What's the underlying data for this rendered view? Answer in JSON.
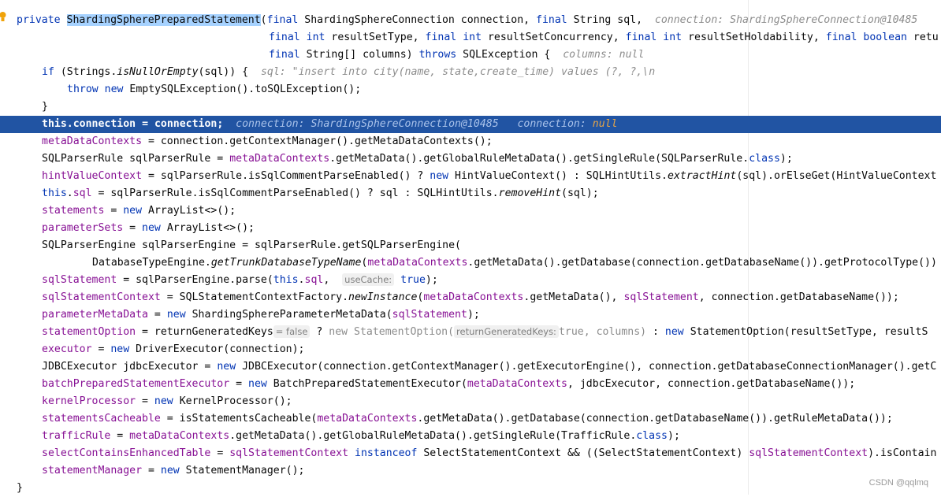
{
  "watermark": "CSDN @qqlmq",
  "lines": {
    "l1": {
      "kw_private": "private",
      "class_name": "ShardingSpherePreparedStatement",
      "sig_rest": "(",
      "kw_final": "final",
      "sig_text": " ShardingSphereConnection connection, ",
      "kw_final2": "final",
      "sig_text2": " String sql,",
      "hint": "connection: ShardingSphereConnection@10485"
    },
    "l2": {
      "kw1": "final",
      "kw2": "int",
      "t1": " resultSetType, ",
      "kw3": "final",
      "kw4": "int",
      "t2": " resultSetConcurrency, ",
      "kw5": "final",
      "kw6": "int",
      "t3": " resultSetHoldability, ",
      "kw7": "final",
      "kw8": "boolean",
      "t4": " retu"
    },
    "l3": {
      "kw1": "final",
      "t1": " String[] columns) ",
      "kw2": "throws",
      "t2": " SQLException {",
      "hint": "columns: null"
    },
    "l4": {
      "kw1": "if",
      "t1": " (Strings.",
      "m1": "isNullOrEmpty",
      "t2": "(sql)) {",
      "hint": "sql: \"insert into city(name, state,create_time) values (?, ?,\\n"
    },
    "l5": {
      "kw1": "throw",
      "kw2": "new",
      "t1": " EmptySQLException().toSQLException();"
    },
    "l6": {
      "t1": "}"
    },
    "l7": {
      "kw1": "this",
      "t1": ".",
      "f1": "connection",
      "t2": " = connection;",
      "hint1": "connection: ShardingSphereConnection@10485",
      "hint2": "connection:",
      "hint3": "null"
    },
    "l8": {
      "f1": "metaDataContexts",
      "t1": " = connection.getContextManager().getMetaDataContexts();"
    },
    "l9": {
      "t1": "SQLParserRule sqlParserRule = ",
      "f1": "metaDataContexts",
      "t2": ".getMetaData().getGlobalRuleMetaData().getSingleRule(SQLParserRule.",
      "kw1": "class",
      "t3": ");"
    },
    "l10": {
      "f1": "hintValueContext",
      "t1": " = sqlParserRule.isSqlCommentParseEnabled() ? ",
      "kw1": "new",
      "t2": " HintValueContext() : SQLHintUtils.",
      "m1": "extractHint",
      "t3": "(sql).orElseGet(HintValueContext"
    },
    "l11": {
      "kw1": "this",
      "t1": ".",
      "f1": "sql",
      "t2": " = sqlParserRule.isSqlCommentParseEnabled() ? sql : SQLHintUtils.",
      "m1": "removeHint",
      "t3": "(sql);"
    },
    "l12": {
      "f1": "statements",
      "t1": " = ",
      "kw1": "new",
      "t2": " ArrayList<>();"
    },
    "l13": {
      "f1": "parameterSets",
      "t1": " = ",
      "kw1": "new",
      "t2": " ArrayList<>();"
    },
    "l14": {
      "t1": "SQLParserEngine sqlParserEngine = sqlParserRule.getSQLParserEngine("
    },
    "l15": {
      "t1": "DatabaseTypeEngine.",
      "m1": "getTrunkDatabaseTypeName",
      "t2": "(",
      "f1": "metaDataContexts",
      "t3": ".getMetaData().getDatabase(connection.getDatabaseName()).getProtocolType())"
    },
    "l16": {
      "f1": "sqlStatement",
      "t1": " = sqlParserEngine.parse(",
      "kw1": "this",
      "t2": ".",
      "f2": "sql",
      "t3": ",",
      "inlay": "useCache:",
      "kw2": "true",
      "t4": ");"
    },
    "l17": {
      "f1": "sqlStatementContext",
      "t1": " = SQLStatementContextFactory.",
      "m1": "newInstance",
      "t2": "(",
      "f2": "metaDataContexts",
      "t3": ".getMetaData(), ",
      "f3": "sqlStatement",
      "t4": ", connection.getDatabaseName());"
    },
    "l18": {
      "f1": "parameterMetaData",
      "t1": " = ",
      "kw1": "new",
      "t2": " ShardingSphereParameterMetaData(",
      "f2": "sqlStatement",
      "t3": ");"
    },
    "l19": {
      "f1": "statementOption",
      "t1": " = returnGeneratedKeys",
      "inlay1": "= false",
      "t2": " ? ",
      "g1": "new StatementOption(",
      "inlay2": "returnGeneratedKeys:",
      "g2": "true, columns)",
      "t3": " : ",
      "kw1": "new",
      "t4": " StatementOption(resultSetType, resultS"
    },
    "l20": {
      "f1": "executor",
      "t1": " = ",
      "kw1": "new",
      "t2": " DriverExecutor(connection);"
    },
    "l21": {
      "t1": "JDBCExecutor jdbcExecutor = ",
      "kw1": "new",
      "t2": " JDBCExecutor(connection.getContextManager().getExecutorEngine(), connection.getDatabaseConnectionManager().getC"
    },
    "l22": {
      "f1": "batchPreparedStatementExecutor",
      "t1": " = ",
      "kw1": "new",
      "t2": " BatchPreparedStatementExecutor(",
      "f2": "metaDataContexts",
      "t3": ", jdbcExecutor, connection.getDatabaseName());"
    },
    "l23": {
      "f1": "kernelProcessor",
      "t1": " = ",
      "kw1": "new",
      "t2": " KernelProcessor();"
    },
    "l24": {
      "f1": "statementsCacheable",
      "t1": " = isStatementsCacheable(",
      "f2": "metaDataContexts",
      "t2": ".getMetaData().getDatabase(connection.getDatabaseName()).getRuleMetaData());"
    },
    "l25": {
      "f1": "trafficRule",
      "t1": " = ",
      "f2": "metaDataContexts",
      "t2": ".getMetaData().getGlobalRuleMetaData().getSingleRule(TrafficRule.",
      "kw1": "class",
      "t3": ");"
    },
    "l26": {
      "f1": "selectContainsEnhancedTable",
      "t1": " = ",
      "f2": "sqlStatementContext",
      "t2": " ",
      "kw1": "instanceof",
      "t3": " SelectStatementContext && ((SelectStatementContext) ",
      "f3": "sqlStatementContext",
      "t4": ").isContain"
    },
    "l27": {
      "f1": "statementManager",
      "t1": " = ",
      "kw1": "new",
      "t2": " StatementManager();"
    },
    "l28": {
      "t1": "}"
    }
  }
}
